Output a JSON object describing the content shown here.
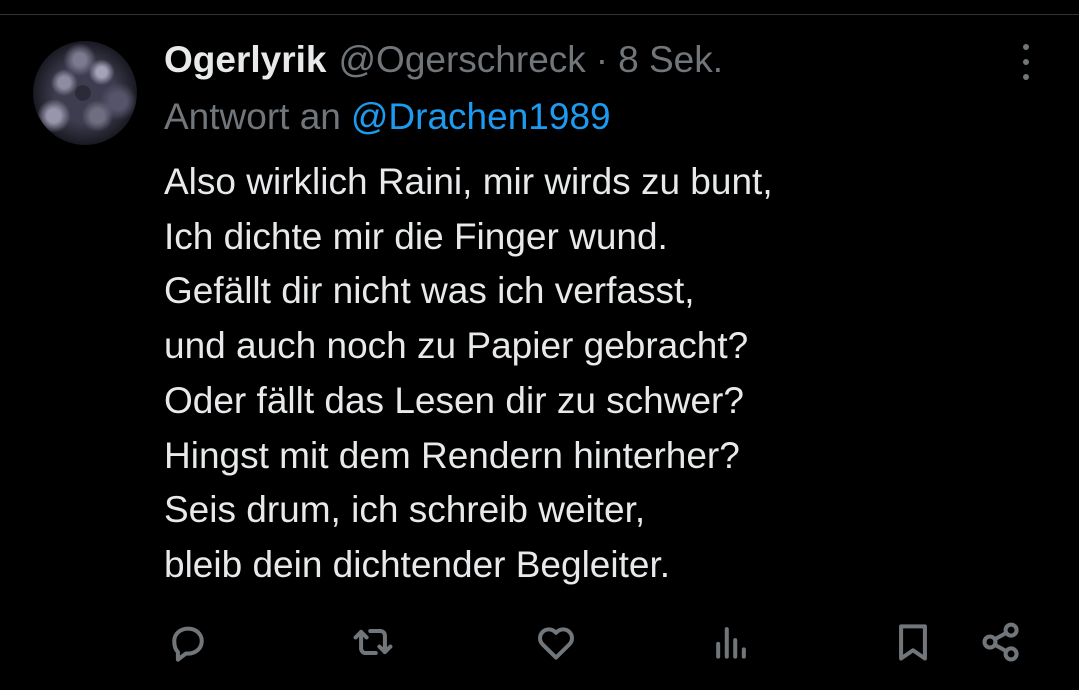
{
  "post": {
    "display_name": "Ogerlyrik",
    "handle": "@Ogerschreck",
    "separator": "·",
    "time": "8 Sek.",
    "reply_prefix": "Antwort an",
    "reply_mention": "@Drachen1989",
    "lines": [
      "Also wirklich Raini, mir wirds zu bunt,",
      "Ich dichte mir die Finger wund.",
      "Gefällt dir nicht was ich verfasst,",
      "und auch noch zu Papier gebracht?",
      "Oder fällt das Lesen dir zu schwer?",
      "Hingst mit dem Rendern hinterher?",
      "Seis drum, ich schreib weiter,",
      "bleib dein dichtender Begleiter."
    ]
  },
  "icons": {
    "more": "more-vertical-icon",
    "reply": "reply-icon",
    "repost": "repost-icon",
    "like": "heart-icon",
    "views": "views-icon",
    "bookmark": "bookmark-icon",
    "share": "share-icon"
  },
  "colors": {
    "background": "#000000",
    "text": "#e7e9ea",
    "secondary": "#71767b",
    "link": "#1d9bf0",
    "divider": "#2f3336"
  }
}
